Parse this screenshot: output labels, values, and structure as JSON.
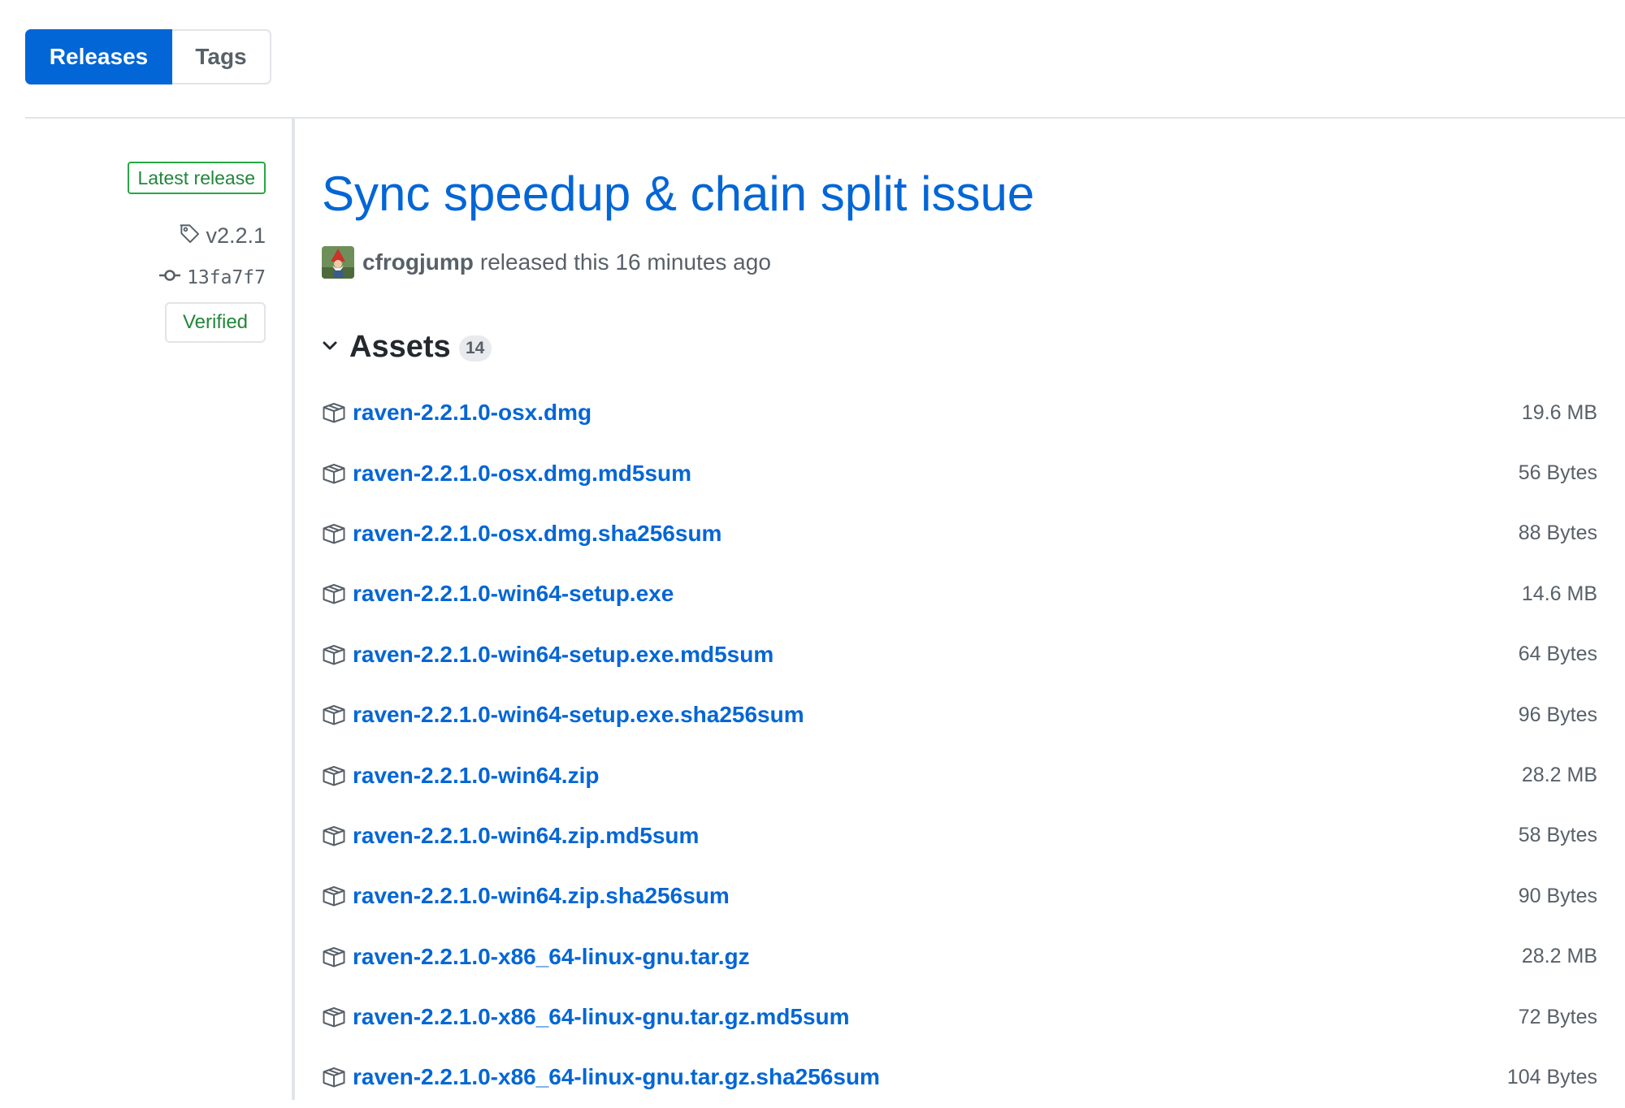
{
  "tabs": {
    "releases": "Releases",
    "tags": "Tags"
  },
  "sidebar": {
    "latest_badge": "Latest release",
    "tag": "v2.2.1",
    "commit": "13fa7f7",
    "verified": "Verified"
  },
  "release": {
    "title": "Sync speedup & chain split issue",
    "author": "cfrogjump",
    "released_text": "released this 16 minutes ago"
  },
  "assets": {
    "title": "Assets",
    "count": "14",
    "items": [
      {
        "name": "raven-2.2.1.0-osx.dmg",
        "size": "19.6 MB"
      },
      {
        "name": "raven-2.2.1.0-osx.dmg.md5sum",
        "size": "56 Bytes"
      },
      {
        "name": "raven-2.2.1.0-osx.dmg.sha256sum",
        "size": "88 Bytes"
      },
      {
        "name": "raven-2.2.1.0-win64-setup.exe",
        "size": "14.6 MB"
      },
      {
        "name": "raven-2.2.1.0-win64-setup.exe.md5sum",
        "size": "64 Bytes"
      },
      {
        "name": "raven-2.2.1.0-win64-setup.exe.sha256sum",
        "size": "96 Bytes"
      },
      {
        "name": "raven-2.2.1.0-win64.zip",
        "size": "28.2 MB"
      },
      {
        "name": "raven-2.2.1.0-win64.zip.md5sum",
        "size": "58 Bytes"
      },
      {
        "name": "raven-2.2.1.0-win64.zip.sha256sum",
        "size": "90 Bytes"
      },
      {
        "name": "raven-2.2.1.0-x86_64-linux-gnu.tar.gz",
        "size": "28.2 MB"
      },
      {
        "name": "raven-2.2.1.0-x86_64-linux-gnu.tar.gz.md5sum",
        "size": "72 Bytes"
      },
      {
        "name": "raven-2.2.1.0-x86_64-linux-gnu.tar.gz.sha256sum",
        "size": "104 Bytes"
      }
    ]
  },
  "icons": {
    "tag": "tag-icon",
    "commit": "commit-icon",
    "chevron": "chevron-down-icon",
    "package": "package-icon"
  },
  "colors": {
    "accent": "#0366d6",
    "success": "#28a745",
    "muted": "#586069"
  }
}
